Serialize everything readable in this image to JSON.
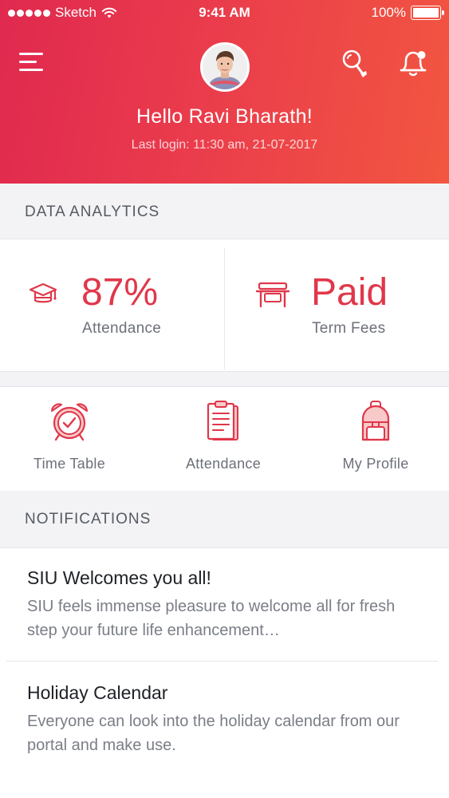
{
  "status_bar": {
    "carrier": "Sketch",
    "time": "9:41 AM",
    "battery": "100%"
  },
  "header": {
    "greeting": "Hello Ravi Bharath!",
    "last_login": "Last login: 11:30 am, 21-07-2017"
  },
  "icons": {
    "menu": "menu-icon",
    "search": "search-icon",
    "notifications": "bell-icon"
  },
  "colors": {
    "accent": "#e0374a",
    "header_start": "#e0294f",
    "header_end": "#f25640"
  },
  "data_analytics": {
    "title": "DATA ANALYTICS",
    "attendance": {
      "value": "87%",
      "label": "Attendance",
      "icon": "graduation-cap-icon"
    },
    "fees": {
      "value": "Paid",
      "label": "Term Fees",
      "icon": "desk-icon"
    }
  },
  "quick_links": [
    {
      "label": "Time Table",
      "icon": "alarm-clock-icon"
    },
    {
      "label": "Attendance",
      "icon": "clipboard-icon"
    },
    {
      "label": "My Profile",
      "icon": "backpack-icon"
    }
  ],
  "notifications": {
    "title": "NOTIFICATIONS",
    "items": [
      {
        "title": "SIU Welcomes you all!",
        "body": "SIU feels immense pleasure to welcome all for fresh step your future life enhancement…"
      },
      {
        "title": "Holiday Calendar",
        "body": "Everyone can look into the holiday calendar from our portal and make use."
      }
    ]
  }
}
